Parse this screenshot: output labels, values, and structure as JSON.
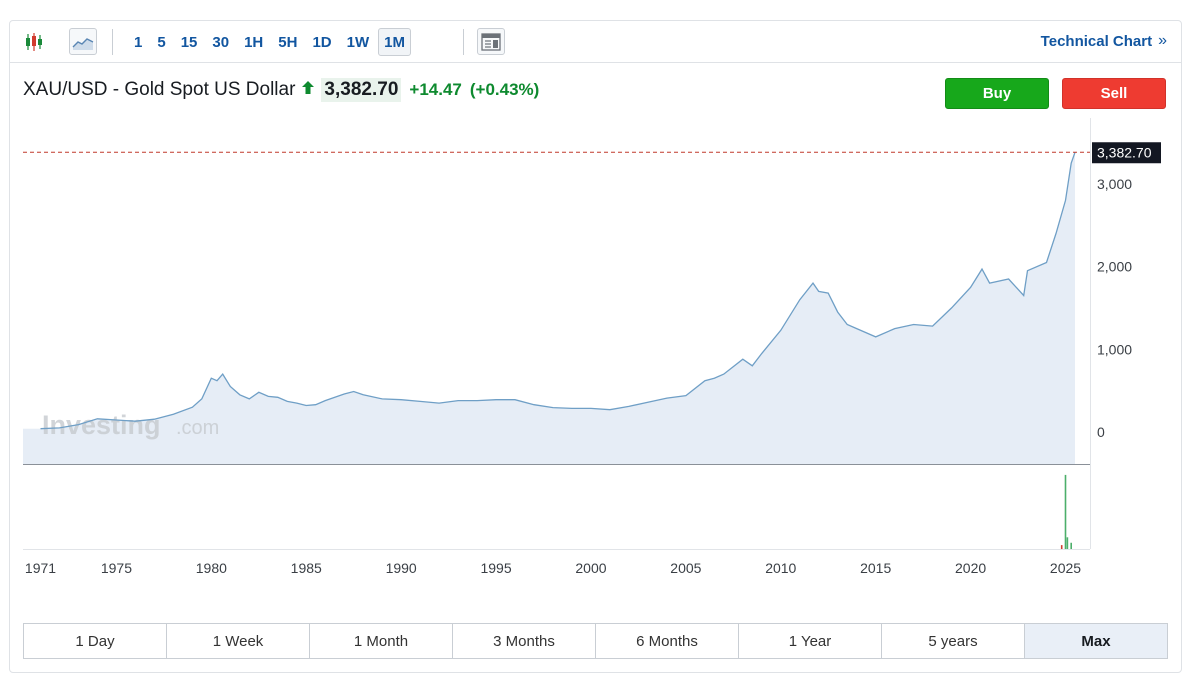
{
  "toolbar": {
    "intervals": [
      "1",
      "5",
      "15",
      "30",
      "1H",
      "5H",
      "1D",
      "1W",
      "1M"
    ],
    "active_interval": "1M",
    "technical_chart_label": "Technical Chart",
    "icons": [
      "candlestick-icon",
      "line-chart-icon",
      "news-table-icon",
      "double-chevron-right-icon"
    ]
  },
  "header": {
    "instrument": "XAU/USD - Gold Spot US Dollar",
    "price": "3,382.70",
    "change": "+14.47",
    "change_pct": "(+0.43%)",
    "direction": "up",
    "buy_label": "Buy",
    "sell_label": "Sell"
  },
  "colors": {
    "accent": "#1256a0",
    "up": "#0e8a2f",
    "buy": "#17a81b",
    "sell": "#ee3b31",
    "line": "#6f9fc6",
    "area": "#e6edf6",
    "last_price_line": "#c0392b"
  },
  "watermark": {
    "brand": "Investing",
    "suffix": ".com"
  },
  "ranges": {
    "options": [
      "1 Day",
      "1 Week",
      "1 Month",
      "3 Months",
      "6 Months",
      "1 Year",
      "5 years",
      "Max"
    ],
    "active": "Max"
  },
  "chart_data": {
    "type": "area",
    "title": "",
    "xlabel": "",
    "ylabel": "",
    "x_ticks": [
      "1971",
      "1975",
      "1980",
      "1985",
      "1990",
      "1995",
      "2000",
      "2005",
      "2010",
      "2015",
      "2020",
      "2025"
    ],
    "y_ticks": [
      "0",
      "1,000",
      "2,000",
      "3,000"
    ],
    "ylim": [
      0,
      3450
    ],
    "last_price_label": "3,382.70",
    "grid": false,
    "series": [
      {
        "x": [
          1971,
          1972,
          1973,
          1974,
          1975,
          1976,
          1977,
          1978,
          1979,
          1979.5,
          1980,
          1980.3,
          1980.6,
          1981,
          1981.5,
          1982,
          1982.5,
          1983,
          1983.5,
          1984,
          1984.5,
          1985,
          1985.5,
          1986,
          1987,
          1987.5,
          1988,
          1989,
          1990,
          1991,
          1992,
          1993,
          1994,
          1995,
          1996,
          1997,
          1998,
          1999,
          2000,
          2001,
          2002,
          2003,
          2004,
          2005,
          2006,
          2006.5,
          2007,
          2008,
          2008.5,
          2009,
          2010,
          2011,
          2011.7,
          2012,
          2012.5,
          2013,
          2013.5,
          2014,
          2015,
          2016,
          2017,
          2018,
          2019,
          2020,
          2020.6,
          2021,
          2022,
          2022.8,
          2023,
          2024,
          2024.5,
          2025,
          2025.3,
          2025.5
        ],
        "values": [
          40,
          50,
          90,
          160,
          145,
          130,
          155,
          215,
          300,
          400,
          650,
          620,
          700,
          550,
          450,
          400,
          480,
          430,
          420,
          370,
          350,
          320,
          330,
          380,
          460,
          490,
          450,
          400,
          390,
          370,
          350,
          380,
          380,
          390,
          390,
          330,
          295,
          285,
          285,
          270,
          310,
          360,
          410,
          440,
          620,
          650,
          700,
          880,
          800,
          950,
          1230,
          1600,
          1800,
          1700,
          1680,
          1450,
          1300,
          1250,
          1150,
          1250,
          1300,
          1280,
          1500,
          1750,
          1970,
          1800,
          1850,
          1650,
          1950,
          2050,
          2400,
          2800,
          3250,
          3382.7
        ]
      }
    ],
    "volume": {
      "x": [
        2024.8,
        2025.0,
        2025.1,
        2025.3
      ],
      "values": [
        0.05,
        0.95,
        0.15,
        0.08
      ]
    }
  }
}
